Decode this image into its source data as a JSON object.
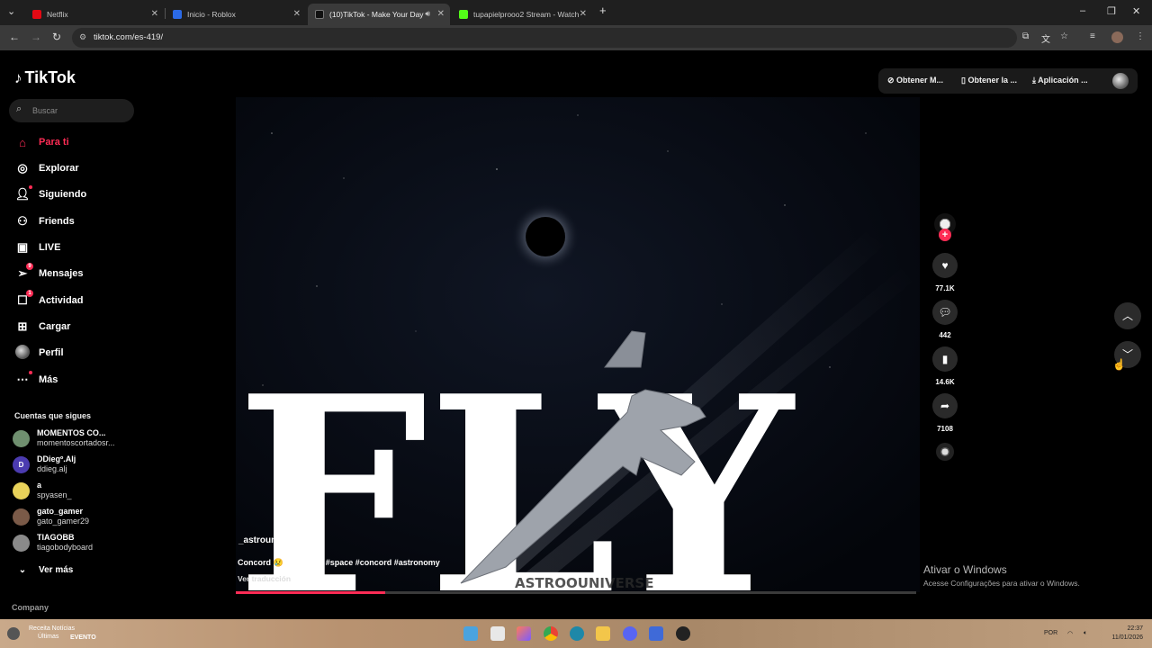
{
  "browser": {
    "tabs": [
      {
        "title": "Netflix",
        "color": "#e50914"
      },
      {
        "title": "Inicio - Roblox",
        "color": "#2b6ae6"
      },
      {
        "title": "(10)TikTok - Make Your Day",
        "color": "#111111"
      },
      {
        "title": "tupapielprooo2 Stream - Watch",
        "color": "#53fc18"
      }
    ],
    "url": "tiktok.com/es-419/"
  },
  "sidebar": {
    "logo": "TikTok",
    "search_placeholder": "Buscar",
    "nav": [
      {
        "label": "Para ti",
        "icon": "home-icon",
        "active": true
      },
      {
        "label": "Explorar",
        "icon": "compass-icon"
      },
      {
        "label": "Siguiendo",
        "icon": "following-icon",
        "dot": true
      },
      {
        "label": "Friends",
        "icon": "friends-icon"
      },
      {
        "label": "LIVE",
        "icon": "live-icon"
      },
      {
        "label": "Mensajes",
        "icon": "send-icon",
        "badge": "9"
      },
      {
        "label": "Actividad",
        "icon": "activity-icon",
        "badge": "1"
      },
      {
        "label": "Cargar",
        "icon": "upload-icon"
      },
      {
        "label": "Perfil",
        "icon": "profile-avatar-icon"
      },
      {
        "label": "Más",
        "icon": "more-icon",
        "dot": true
      }
    ],
    "following_title": "Cuentas que sigues",
    "following": [
      {
        "name": "MOMENTOS CO...",
        "handle": "momentoscortadosr...",
        "avatar_color": "#6f8f6f",
        "initial": ""
      },
      {
        "name": "DDiegº.Alj",
        "handle": "ddieg.alj",
        "avatar_color": "#4b3bb0",
        "initial": "D"
      },
      {
        "name": "a",
        "handle": "spyasen_",
        "avatar_color": "#e8d25a",
        "initial": ""
      },
      {
        "name": "gato_gamer",
        "handle": "gato_gamer29",
        "avatar_color": "#7a5a48",
        "initial": ""
      },
      {
        "name": "TIAGOBB",
        "handle": "tiagobodyboard",
        "avatar_color": "#8a8a8a",
        "initial": ""
      }
    ],
    "see_more": "Ver más",
    "company": "Company"
  },
  "top_actions": [
    "Obtener M...",
    "Obtener la ...",
    "Aplicación ..."
  ],
  "video": {
    "title_letters": "FLY",
    "watermark": "ASTROOUNIVERSE",
    "username": "_astrouniverse_",
    "caption": "Concord 😢 #universe #space #concord #astronomy",
    "translate": "Ver traducción",
    "progress_fraction": 0.22
  },
  "actions": {
    "likes": "77.1K",
    "comments": "442",
    "saves": "14.6K",
    "shares": "7108"
  },
  "windows": {
    "activate_title": "Ativar o Windows",
    "activate_sub": "Acesse Configurações para ativar o Windows.",
    "taskbar_news_1": "Receita Notícias",
    "taskbar_news_2": "Últimas",
    "taskbar_news_3": "EVENTO",
    "lang": "POR",
    "time": "22:37",
    "date": "11/01/2026"
  }
}
